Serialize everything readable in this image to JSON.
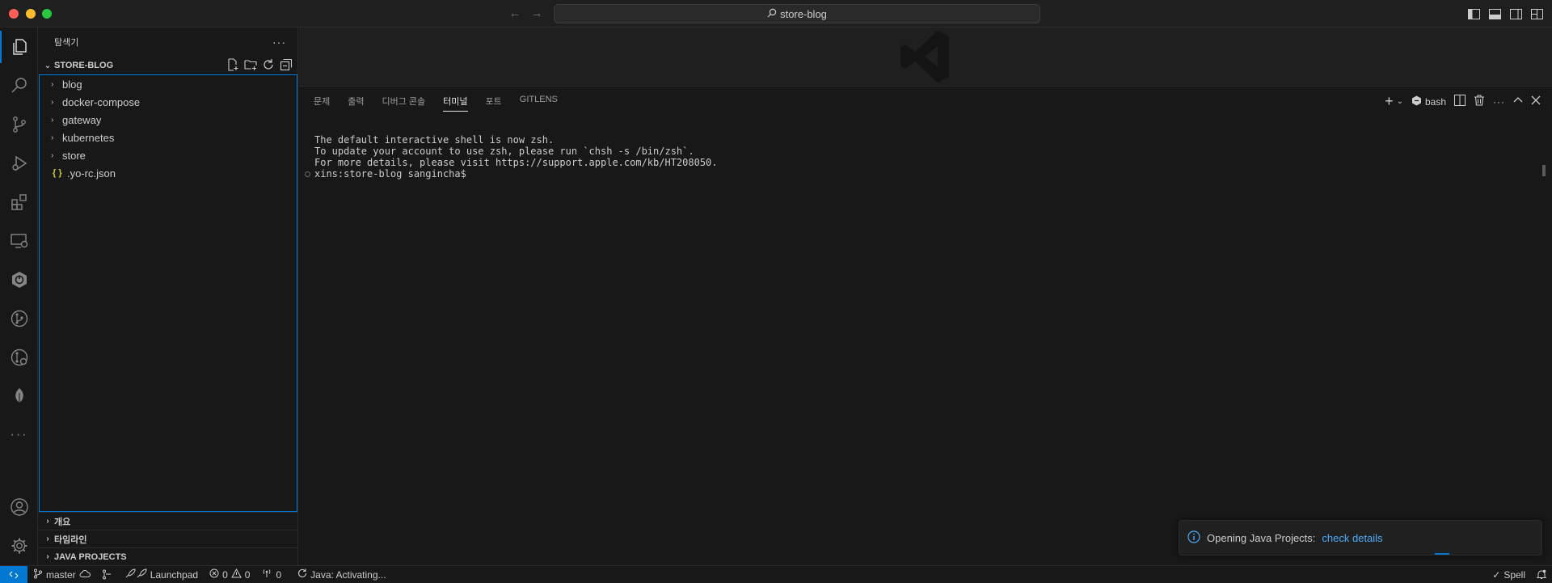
{
  "window": {
    "search_text": "store-blog"
  },
  "sidebar": {
    "title": "탐색기",
    "more": "···",
    "project": "STORE-BLOG",
    "items": [
      {
        "label": "blog",
        "type": "folder"
      },
      {
        "label": "docker-compose",
        "type": "folder"
      },
      {
        "label": "gateway",
        "type": "folder"
      },
      {
        "label": "kubernetes",
        "type": "folder"
      },
      {
        "label": "store",
        "type": "folder"
      },
      {
        "label": ".yo-rc.json",
        "type": "json",
        "icon": "{ }"
      }
    ],
    "sections": [
      "개요",
      "타임라인",
      "JAVA PROJECTS"
    ]
  },
  "panel": {
    "tabs": [
      "문제",
      "출력",
      "디버그 콘솔",
      "터미널",
      "포트",
      "GITLENS"
    ],
    "active_tab": "터미널",
    "shell": "bash",
    "terminal_lines": [
      "The default interactive shell is now zsh.",
      "To update your account to use zsh, please run `chsh -s /bin/zsh`.",
      "For more details, please visit https://support.apple.com/kb/HT208050.",
      "xins:store-blog sangincha$ "
    ]
  },
  "toast": {
    "message": "Opening Java Projects:",
    "link": "check details"
  },
  "statusbar": {
    "branch": "master",
    "launchpad": "Launchpad",
    "errors": "0",
    "warnings": "0",
    "ports": "0",
    "java_status": "Java: Activating...",
    "spell": "Spell"
  },
  "colors": {
    "accent": "#0078d4",
    "link": "#4daafc",
    "json": "#cbcb41"
  }
}
